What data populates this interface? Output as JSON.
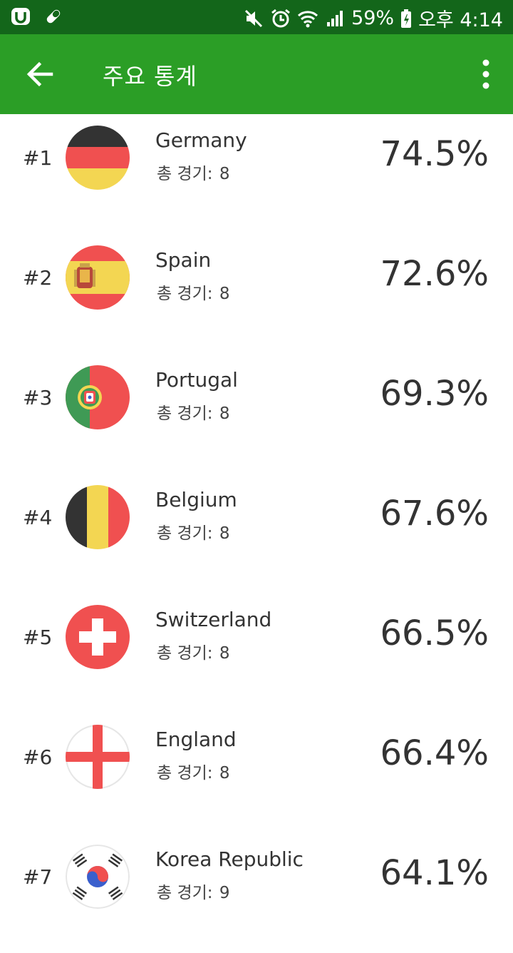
{
  "status_bar": {
    "battery": "59%",
    "time": "오후 4:14",
    "icons": [
      "u-app-icon",
      "pill-icon",
      "mute-icon",
      "alarm-icon",
      "wifi-icon",
      "signal-icon",
      "battery-icon"
    ]
  },
  "app_bar": {
    "title": "주요 통계",
    "back_icon": "arrow-left-icon",
    "menu_icon": "more-vert-icon"
  },
  "colors": {
    "status_bar": "#13661a",
    "app_bar": "#2b9e26",
    "text": "#333333"
  },
  "teams": [
    {
      "rank": "#1",
      "name": "Germany",
      "games_label": "총 경기:",
      "games": "8",
      "pct": "74.5%",
      "flag": "germany-flag-icon"
    },
    {
      "rank": "#2",
      "name": "Spain",
      "games_label": "총 경기:",
      "games": "8",
      "pct": "72.6%",
      "flag": "spain-flag-icon"
    },
    {
      "rank": "#3",
      "name": "Portugal",
      "games_label": "총 경기:",
      "games": "8",
      "pct": "69.3%",
      "flag": "portugal-flag-icon"
    },
    {
      "rank": "#4",
      "name": "Belgium",
      "games_label": "총 경기:",
      "games": "8",
      "pct": "67.6%",
      "flag": "belgium-flag-icon"
    },
    {
      "rank": "#5",
      "name": "Switzerland",
      "games_label": "총 경기:",
      "games": "8",
      "pct": "66.5%",
      "flag": "switzerland-flag-icon"
    },
    {
      "rank": "#6",
      "name": "England",
      "games_label": "총 경기:",
      "games": "8",
      "pct": "66.4%",
      "flag": "england-flag-icon"
    },
    {
      "rank": "#7",
      "name": "Korea Republic",
      "games_label": "총 경기:",
      "games": "9",
      "pct": "64.1%",
      "flag": "korea-flag-icon"
    }
  ]
}
